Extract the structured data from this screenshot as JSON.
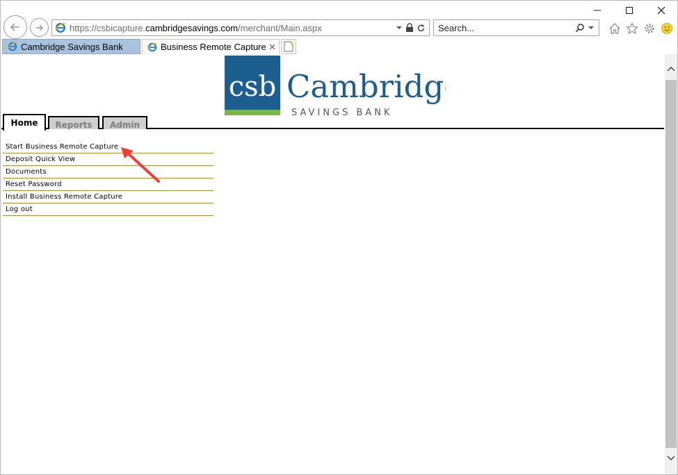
{
  "browser": {
    "address": {
      "url_prefix": "https://csbicapture.",
      "url_domain": "cambridgesavings.com",
      "url_path": "/merchant/Main.aspx"
    },
    "search": {
      "placeholder": "Search..."
    },
    "tabs": [
      {
        "title": "Cambridge Savings Bank",
        "active": false
      },
      {
        "title": "Business Remote Capture",
        "active": true
      }
    ],
    "caption": {
      "minimize": "—",
      "maximize": "☐",
      "close": "✕"
    }
  },
  "logo": {
    "mark": "csb",
    "name": "Cambridge",
    "tagline": "SAVINGS BANK",
    "colors": {
      "blue": "#1b5e8f",
      "green": "#7ab648"
    }
  },
  "page_tabs": [
    {
      "label": "Home",
      "active": true
    },
    {
      "label": "Reports",
      "active": false
    },
    {
      "label": "Admin",
      "active": false
    }
  ],
  "menu": [
    {
      "label": "Start Business Remote Capture"
    },
    {
      "label": "Deposit Quick View"
    },
    {
      "label": "Documents"
    },
    {
      "label": "Reset Password"
    },
    {
      "label": "Install Business Remote Capture"
    },
    {
      "label": "Log out"
    }
  ],
  "annotation": {
    "arrow_color": "#e8413a",
    "points_to": "Start Business Remote Capture"
  }
}
